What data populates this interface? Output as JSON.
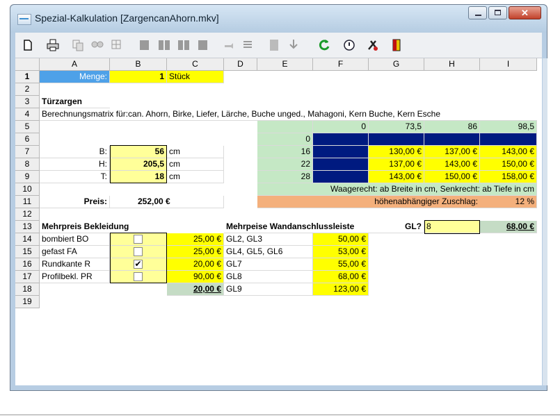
{
  "window": {
    "title": "Spezial-Kalkulation [ZargencanAhorn.mkv]"
  },
  "toolbar_icons": [
    "new-document-icon",
    "print-icon",
    "copy-icon",
    "find-icon",
    "table-icon",
    "book-icon",
    "book-open-icon",
    "books-icon",
    "bookmark-icon",
    "hand-pointer-icon",
    "list-icon",
    "calculator-icon",
    "import-icon",
    "refresh-icon",
    "info-icon",
    "tools-icon",
    "exit-door-icon"
  ],
  "columns": [
    "A",
    "B",
    "C",
    "D",
    "E",
    "F",
    "G",
    "H",
    "I"
  ],
  "rows": [
    "1",
    "2",
    "3",
    "4",
    "5",
    "6",
    "7",
    "8",
    "9",
    "10",
    "11",
    "12",
    "13",
    "14",
    "15",
    "16",
    "17",
    "18",
    "19"
  ],
  "sheet": {
    "menge_label": "Menge:",
    "menge_value": "1",
    "menge_unit": "Stück",
    "heading": "Türzargen",
    "matrix_desc": "Berechnungsmatrix für:can. Ahorn, Birke, Liefer, Lärche, Buche unged., Mahagoni, Kern Buche, Kern Esche",
    "dims": {
      "b_label": "B:",
      "b_value": "56",
      "b_unit": "cm",
      "h_label": "H:",
      "h_value": "205,5",
      "h_unit": "cm",
      "t_label": "T:",
      "t_value": "18",
      "t_unit": "cm"
    },
    "preis_label": "Preis:",
    "preis_value": "252,00 €",
    "matrix": {
      "header": [
        "0",
        "73,5",
        "86",
        "98,5"
      ],
      "rows": [
        {
          "depth": "0",
          "values": [
            "",
            "",
            ""
          ]
        },
        {
          "depth": "16",
          "values": [
            "130,00 €",
            "137,00 €",
            "143,00 €"
          ]
        },
        {
          "depth": "22",
          "values": [
            "137,00 €",
            "143,00 €",
            "150,00 €"
          ]
        },
        {
          "depth": "28",
          "values": [
            "143,00 €",
            "150,00 €",
            "158,00 €"
          ]
        }
      ],
      "note": "Waagerecht: ab Breite in cm, Senkrecht: ab Tiefe in cm",
      "surcharge_label": "höhenabhängiger Zuschlag:",
      "surcharge_value": "12 %"
    },
    "bekleidung": {
      "heading": "Mehrpreis Bekleidung",
      "items": [
        {
          "label": "bombiert BO",
          "checked": "",
          "price": "25,00 €"
        },
        {
          "label": "gefast FA",
          "checked": "",
          "price": "25,00 €"
        },
        {
          "label": "Rundkante R",
          "checked": "✔",
          "price": "20,00 €"
        },
        {
          "label": "Profilbekl. PR",
          "checked": "",
          "price": "90,00 €"
        }
      ],
      "total": "20,00 €"
    },
    "wandanschluss": {
      "heading": "Mehrpeise Wandanschlussleiste",
      "items": [
        {
          "label": "GL2, GL3",
          "price": "50,00 €"
        },
        {
          "label": "GL4, GL5, GL6",
          "price": "53,00 €"
        },
        {
          "label": "GL7",
          "price": "55,00 €"
        },
        {
          "label": "GL8",
          "price": "68,00 €"
        },
        {
          "label": "GL9",
          "price": "123,00 €"
        }
      ],
      "gl_label": "GL?",
      "gl_value": "8",
      "gl_price": "68,00 €"
    }
  },
  "colors": {
    "yellow": "#ffff00",
    "pale_yellow": "#ffff99",
    "green": "#c5e8c5",
    "navy": "#001a80",
    "blue": "#4ea1e8",
    "orange": "#f4b07c"
  }
}
